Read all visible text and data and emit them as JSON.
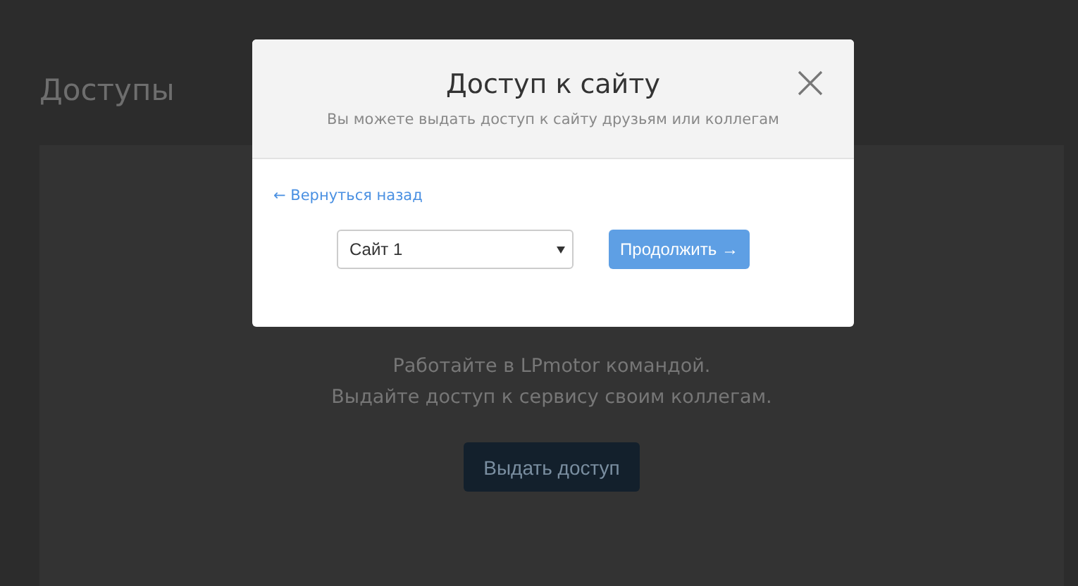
{
  "page": {
    "title": "Доступы",
    "intro": [
      "Работайте в LPmotor командой.",
      "Выдайте доступ к сервису своим коллегам."
    ],
    "button": "Выдать доступ"
  },
  "modal": {
    "title": "Доступ к сайту",
    "subtitle": "Вы можете выдать доступ к сайту друзьям или коллегам",
    "back_link": "← Вернуться назад",
    "site_select": {
      "value": "Сайт 1"
    },
    "continue_button": "Продолжить →"
  }
}
